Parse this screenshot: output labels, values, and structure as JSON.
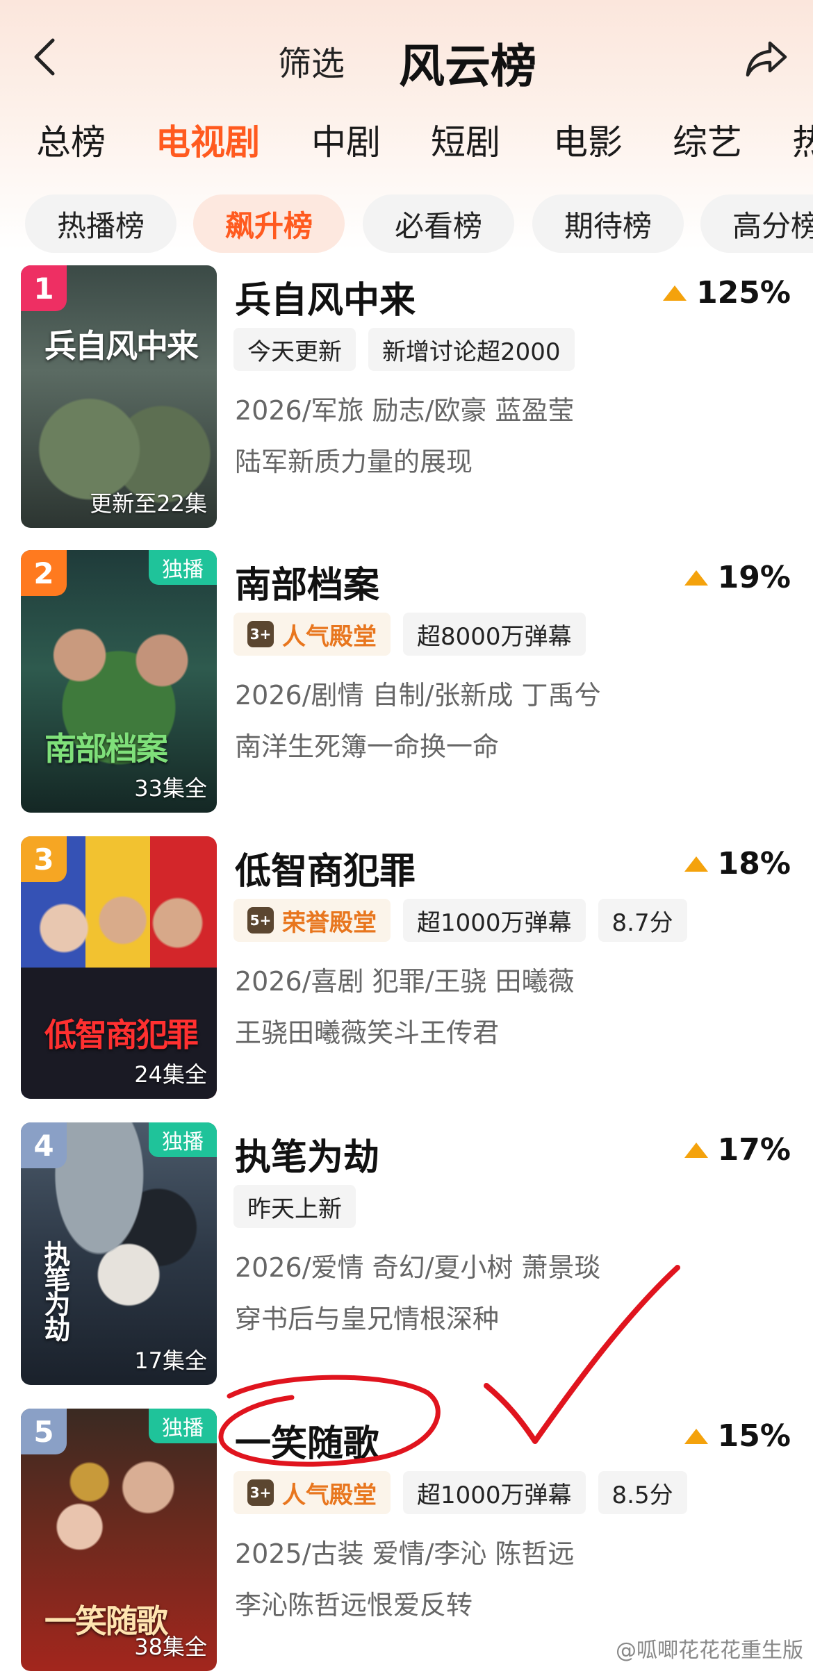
{
  "header": {
    "filter_label": "筛选",
    "title": "风云榜"
  },
  "tabs": [
    {
      "label": "总榜",
      "active": false
    },
    {
      "label": "电视剧",
      "active": true
    },
    {
      "label": "中剧",
      "active": false
    },
    {
      "label": "短剧",
      "active": false
    },
    {
      "label": "电影",
      "active": false
    },
    {
      "label": "综艺",
      "active": false
    },
    {
      "label": "热",
      "active": false
    }
  ],
  "subtabs": [
    {
      "label": "热播榜",
      "active": false
    },
    {
      "label": "飙升榜",
      "active": true
    },
    {
      "label": "必看榜",
      "active": false
    },
    {
      "label": "期待榜",
      "active": false
    },
    {
      "label": "高分榜",
      "active": false
    }
  ],
  "colors": {
    "accent": "#ff5a1f",
    "rank1": "#ee2f63",
    "rank2": "#ff7a1f",
    "rank3": "#f6a623",
    "rank_other": "#8aa0c6",
    "exclusive": "#1fc39a",
    "growth": "#f4a20c",
    "annotation": "#e0141e"
  },
  "items": [
    {
      "rank": "1",
      "name": "兵自风中来",
      "growth": "125%",
      "exclusive": "",
      "tags": [
        {
          "text": "今天更新",
          "hall": false
        },
        {
          "text": "新增讨论超2000",
          "hall": false
        }
      ],
      "meta": "2026/军旅 励志/欧豪 蓝盈莹",
      "desc": "陆军新质力量的展现",
      "episodes": "更新至22集",
      "poster_title": "兵自风中来"
    },
    {
      "rank": "2",
      "name": "南部档案",
      "growth": "19%",
      "exclusive": "独播",
      "tags": [
        {
          "text": "人气殿堂",
          "hall": true,
          "badge": "3+"
        },
        {
          "text": "超8000万弹幕",
          "hall": false
        }
      ],
      "meta": "2026/剧情 自制/张新成 丁禹兮",
      "desc": "南洋生死簿一命换一命",
      "episodes": "33集全",
      "poster_title": "南部档案"
    },
    {
      "rank": "3",
      "name": "低智商犯罪",
      "growth": "18%",
      "exclusive": "",
      "tags": [
        {
          "text": "荣誉殿堂",
          "hall": true,
          "badge": "5+"
        },
        {
          "text": "超1000万弹幕",
          "hall": false
        },
        {
          "text": "8.7分",
          "hall": false
        }
      ],
      "meta": "2026/喜剧 犯罪/王骁 田曦薇",
      "desc": "王骁田曦薇笑斗王传君",
      "episodes": "24集全",
      "poster_title": "低智商犯罪"
    },
    {
      "rank": "4",
      "name": "执笔为劫",
      "growth": "17%",
      "exclusive": "独播",
      "tags": [
        {
          "text": "昨天上新",
          "hall": false
        }
      ],
      "meta": "2026/爱情 奇幻/夏小树 萧景琰",
      "desc": "穿书后与皇兄情根深种",
      "episodes": "17集全",
      "poster_title": "执笔为劫"
    },
    {
      "rank": "5",
      "name": "一笑随歌",
      "growth": "15%",
      "exclusive": "独播",
      "tags": [
        {
          "text": "人气殿堂",
          "hall": true,
          "badge": "3+"
        },
        {
          "text": "超1000万弹幕",
          "hall": false
        },
        {
          "text": "8.5分",
          "hall": false
        }
      ],
      "meta": "2025/古装 爱情/李沁 陈哲远",
      "desc": "李沁陈哲远恨爱反转",
      "episodes": "38集全",
      "poster_title": "一笑随歌"
    }
  ],
  "watermark": "@呱唧花花花重生版"
}
